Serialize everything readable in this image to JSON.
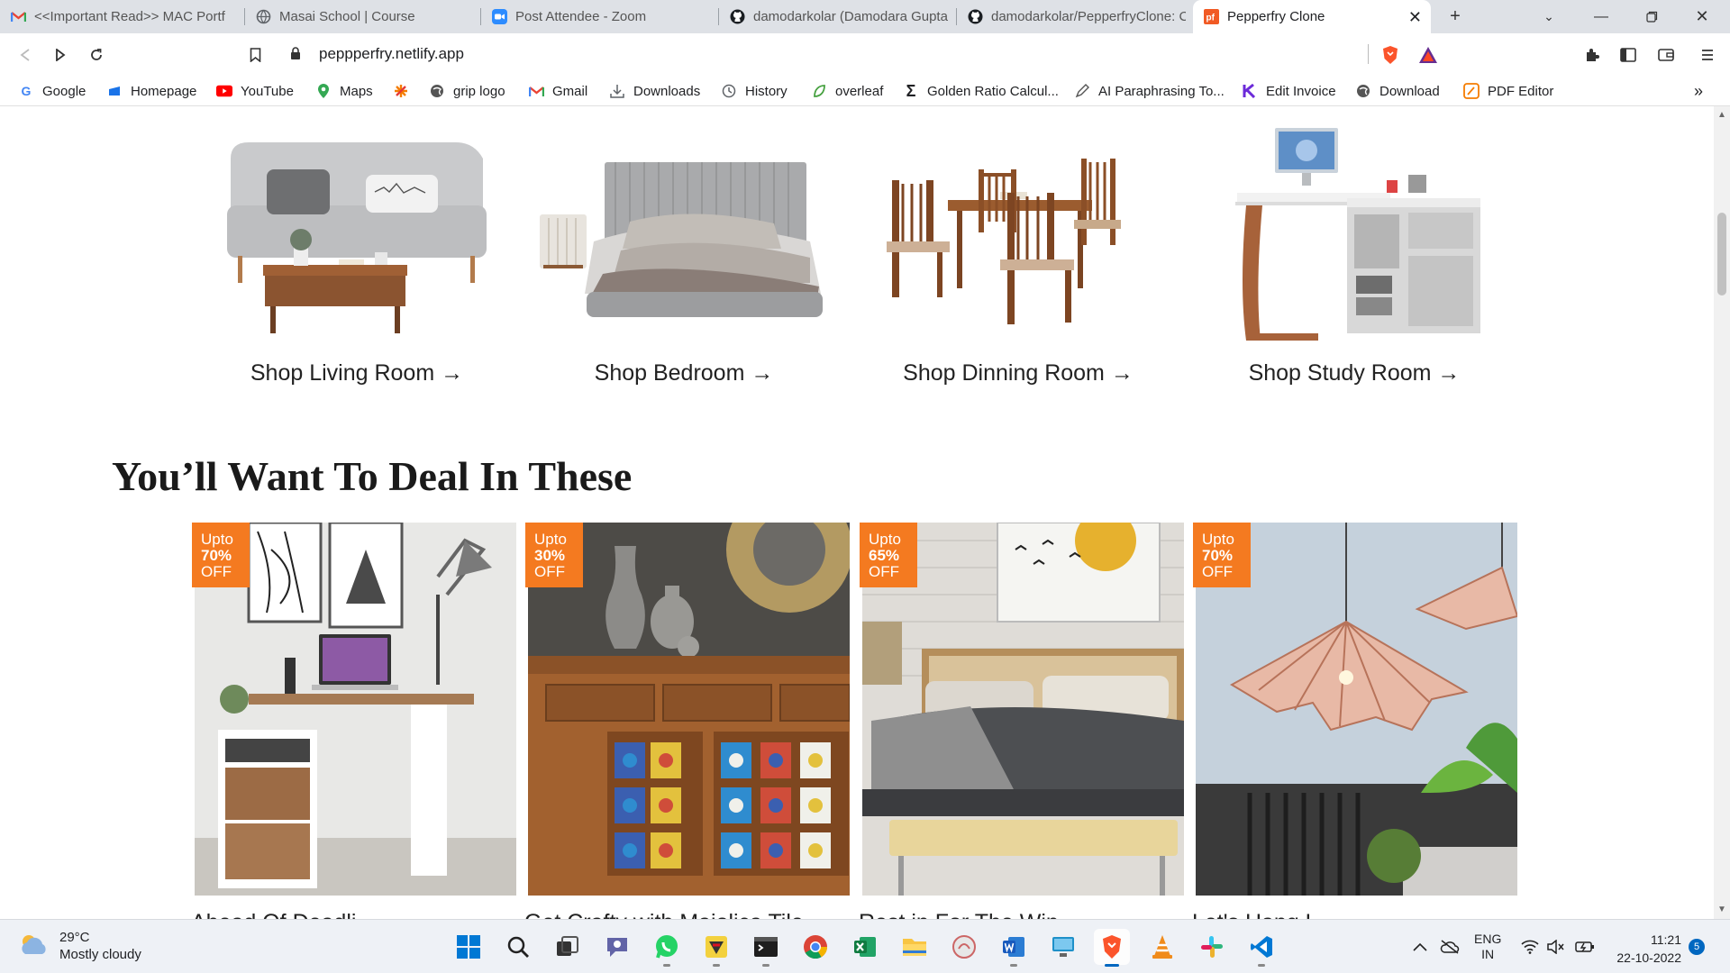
{
  "browser": {
    "tabs": [
      {
        "label": "<<Important Read>> MAC Portf",
        "icon": "gmail-icon"
      },
      {
        "label": "Masai School | Course",
        "icon": "globe-icon"
      },
      {
        "label": "Post Attendee - Zoom",
        "icon": "zoom-icon"
      },
      {
        "label": "damodarkolar (Damodara Gupta",
        "icon": "github-icon"
      },
      {
        "label": "damodarkolar/PepperfryClone: C",
        "icon": "github-icon"
      },
      {
        "label": "Pepperfry Clone",
        "icon": "pepperfry-icon"
      }
    ],
    "new_tab": "+",
    "url": "peppperfry.netlify.app",
    "bookmarks": [
      {
        "label": "Google"
      },
      {
        "label": "Homepage"
      },
      {
        "label": "YouTube"
      },
      {
        "label": "Maps"
      },
      {
        "label": ""
      },
      {
        "label": "grip logo"
      },
      {
        "label": "Gmail"
      },
      {
        "label": "Downloads"
      },
      {
        "label": "History"
      },
      {
        "label": "overleaf"
      },
      {
        "label": "Golden Ratio Calcul..."
      },
      {
        "label": "AI Paraphrasing To..."
      },
      {
        "label": "Edit Invoice"
      },
      {
        "label": "Download"
      },
      {
        "label": "PDF Editor"
      }
    ],
    "more": "»"
  },
  "rooms": [
    {
      "label": "Shop Living Room →"
    },
    {
      "label": "Shop Bedroom →"
    },
    {
      "label": "Shop Dinning Room →"
    },
    {
      "label": "Shop Study Room →"
    }
  ],
  "deals_title": "You’ll Want To Deal In These",
  "deals": [
    {
      "badge_top": "Upto",
      "badge_pct": "70%",
      "badge_bottom": "OFF",
      "caption": "Ahead Of Deadli..."
    },
    {
      "badge_top": "Upto",
      "badge_pct": "30%",
      "badge_bottom": "OFF",
      "caption": "Get Crafty with Majolica Tile..."
    },
    {
      "badge_top": "Upto",
      "badge_pct": "65%",
      "badge_bottom": "OFF",
      "caption": "Rest in For The Win..."
    },
    {
      "badge_top": "Upto",
      "badge_pct": "70%",
      "badge_bottom": "OFF",
      "caption": "Let's Hang L..."
    }
  ],
  "taskbar": {
    "temperature": "29°C",
    "weather": "Mostly cloudy",
    "lang_top": "ENG",
    "lang_bottom": "IN",
    "time": "11:21",
    "date": "22-10-2022",
    "notifications": "5"
  },
  "colors": {
    "badge": "#f47a20",
    "accent_blue": "#0067c0",
    "tabstrip": "#dee1e6"
  }
}
